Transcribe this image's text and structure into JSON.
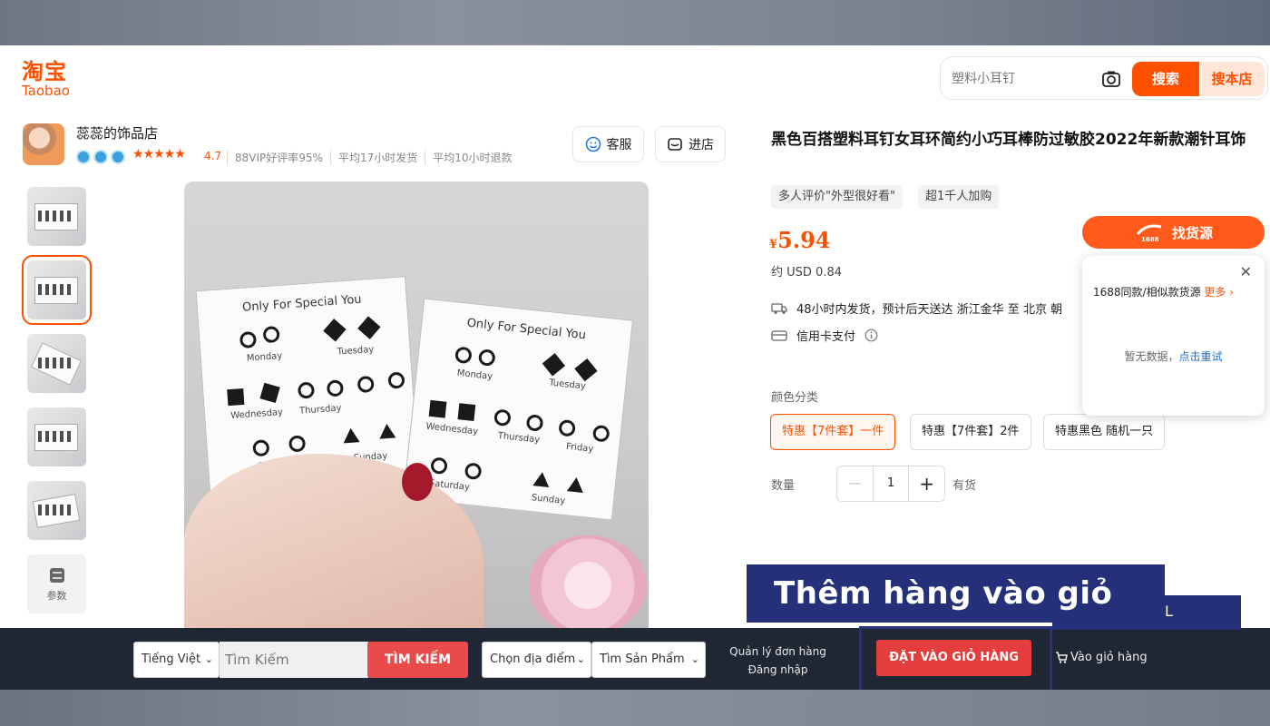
{
  "header": {
    "logo_cn": "淘宝",
    "logo_en": "Taobao",
    "search_placeholder": "塑料小耳钉",
    "search_button": "搜索",
    "store_search_button": "搜本店"
  },
  "store": {
    "name": "蕊蕊的饰品店",
    "rating": "4.7",
    "stats": [
      "88VIP好评率95%",
      "平均17小时发货",
      "平均10小时退款"
    ],
    "service_button": "客服",
    "enter_button": "进店"
  },
  "gallery": {
    "params_label": "参数",
    "image_text": {
      "card_title": "Only For Special You",
      "days": [
        "Monday",
        "Tuesday",
        "Wednesday",
        "Thursday",
        "Friday",
        "Saturday",
        "Sunday"
      ]
    }
  },
  "product": {
    "title": "黑色百搭塑料耳钉女耳环简约小巧耳棒防过敏胶2022年新款潮针耳饰",
    "tags": [
      "多人评价\"外型很好看\"",
      "超1千人加购"
    ],
    "currency_symbol": "¥",
    "price": "5.94",
    "usd": "约 USD 0.84",
    "shipping": "48小时内发货，预计后天送达  浙江金华 至 北京 朝",
    "payment": "信用卡支付",
    "color_label": "颜色分类",
    "options": [
      "特惠【7件套】一件",
      "特惠【7件套】2件",
      "特惠黑色 随机一只"
    ],
    "quantity_label": "数量",
    "quantity": "1",
    "stock": "有货"
  },
  "finder": {
    "button": "找货源",
    "logo_text": "1688",
    "line": "1688同款/相似款货源",
    "more": "更多",
    "no_data": "暂无数据，",
    "retry": "点击重试"
  },
  "extension": {
    "language": "Tiếng Việt",
    "search_placeholder": "Tìm Kiếm",
    "search_button": "TÌM KIẾM",
    "location": "Chọn địa điểm",
    "product_select": "Tìm Sản Phẩm",
    "order_manage": "Quản lý đơn hàng",
    "login": "Đăng nhập",
    "add_to_cart": "ĐẶT VÀO GIỎ HÀNG",
    "cart_link": "Vào giỏ hàng"
  },
  "overlay": {
    "banner": "Thêm hàng vào giỏ",
    "banner_back_letter": "L"
  },
  "colors": {
    "taobao_orange": "#ff5000",
    "extension_bar": "#1f2734",
    "banner_navy": "#25307a",
    "add_to_cart_red": "#e43d3d"
  }
}
